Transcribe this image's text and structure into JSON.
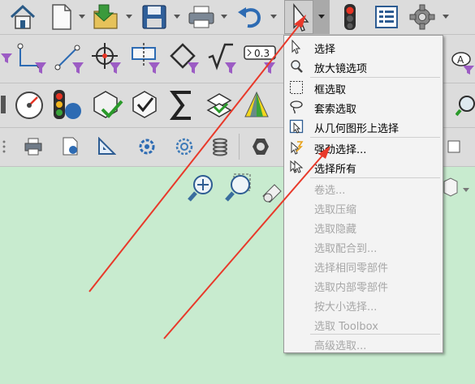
{
  "menu": {
    "items": [
      {
        "label": "选择",
        "icon": "arrow-select-icon",
        "enabled": true
      },
      {
        "label": "放大镜选项",
        "icon": "magnifier-icon",
        "enabled": true
      },
      {
        "label": "框选取",
        "icon": "box-select-icon",
        "enabled": true
      },
      {
        "label": "套索选取",
        "icon": "lasso-icon",
        "enabled": true
      },
      {
        "label": "从几何图形上选择",
        "icon": "geometry-select-icon",
        "enabled": true
      },
      {
        "label": "强劲选择...",
        "icon": "power-select-icon",
        "enabled": true
      },
      {
        "label": "选择所有",
        "icon": "select-all-icon",
        "enabled": true
      },
      {
        "label": "卷选...",
        "enabled": false
      },
      {
        "label": "选取压缩",
        "enabled": false
      },
      {
        "label": "选取隐藏",
        "enabled": false
      },
      {
        "label": "选取配合到...",
        "enabled": false
      },
      {
        "label": "选择相同零部件",
        "enabled": false
      },
      {
        "label": "选取内部零部件",
        "enabled": false
      },
      {
        "label": "按大小选择...",
        "enabled": false
      },
      {
        "label": "选取 Toolbox",
        "enabled": false
      },
      {
        "label": "高级选取...",
        "enabled": false
      }
    ]
  },
  "toolbar": {
    "note_label": "0.3",
    "datum_label": "A"
  },
  "colors": {
    "canvas_bg": "#c8ebcf",
    "toolbar_bg": "#dcdcdc",
    "menu_bg": "#f3f3f3",
    "disabled_text": "#a6a6a6",
    "arrow_annotation": "#e8392a"
  }
}
